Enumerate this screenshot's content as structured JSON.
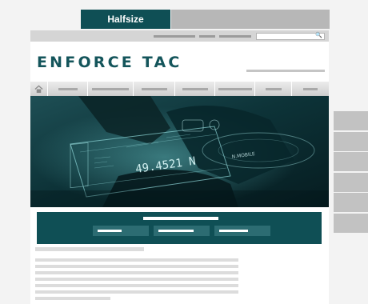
{
  "tabs": {
    "active_label": "Halfsize"
  },
  "site": {
    "brand": "ENFORCE TAC",
    "hero_readout": "49.4521 N"
  },
  "colors": {
    "accent": "#0f4f55",
    "tab_inactive": "#b7b7b7",
    "placeholder_bar": "#c2c2c2"
  }
}
